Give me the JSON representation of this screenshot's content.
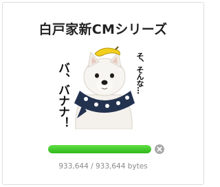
{
  "title": "白戸家新CMシリーズ",
  "sticker": {
    "text_left": "バ、バナナ！",
    "text_right": "そ、そんな…",
    "subject": "white-dog-with-banana-and-scarf"
  },
  "download": {
    "progress": 1.0,
    "bytes_text": "933,644 / 933,644 bytes",
    "cancel_icon": "close-circle-icon",
    "fill_color": "#3ccb25"
  }
}
